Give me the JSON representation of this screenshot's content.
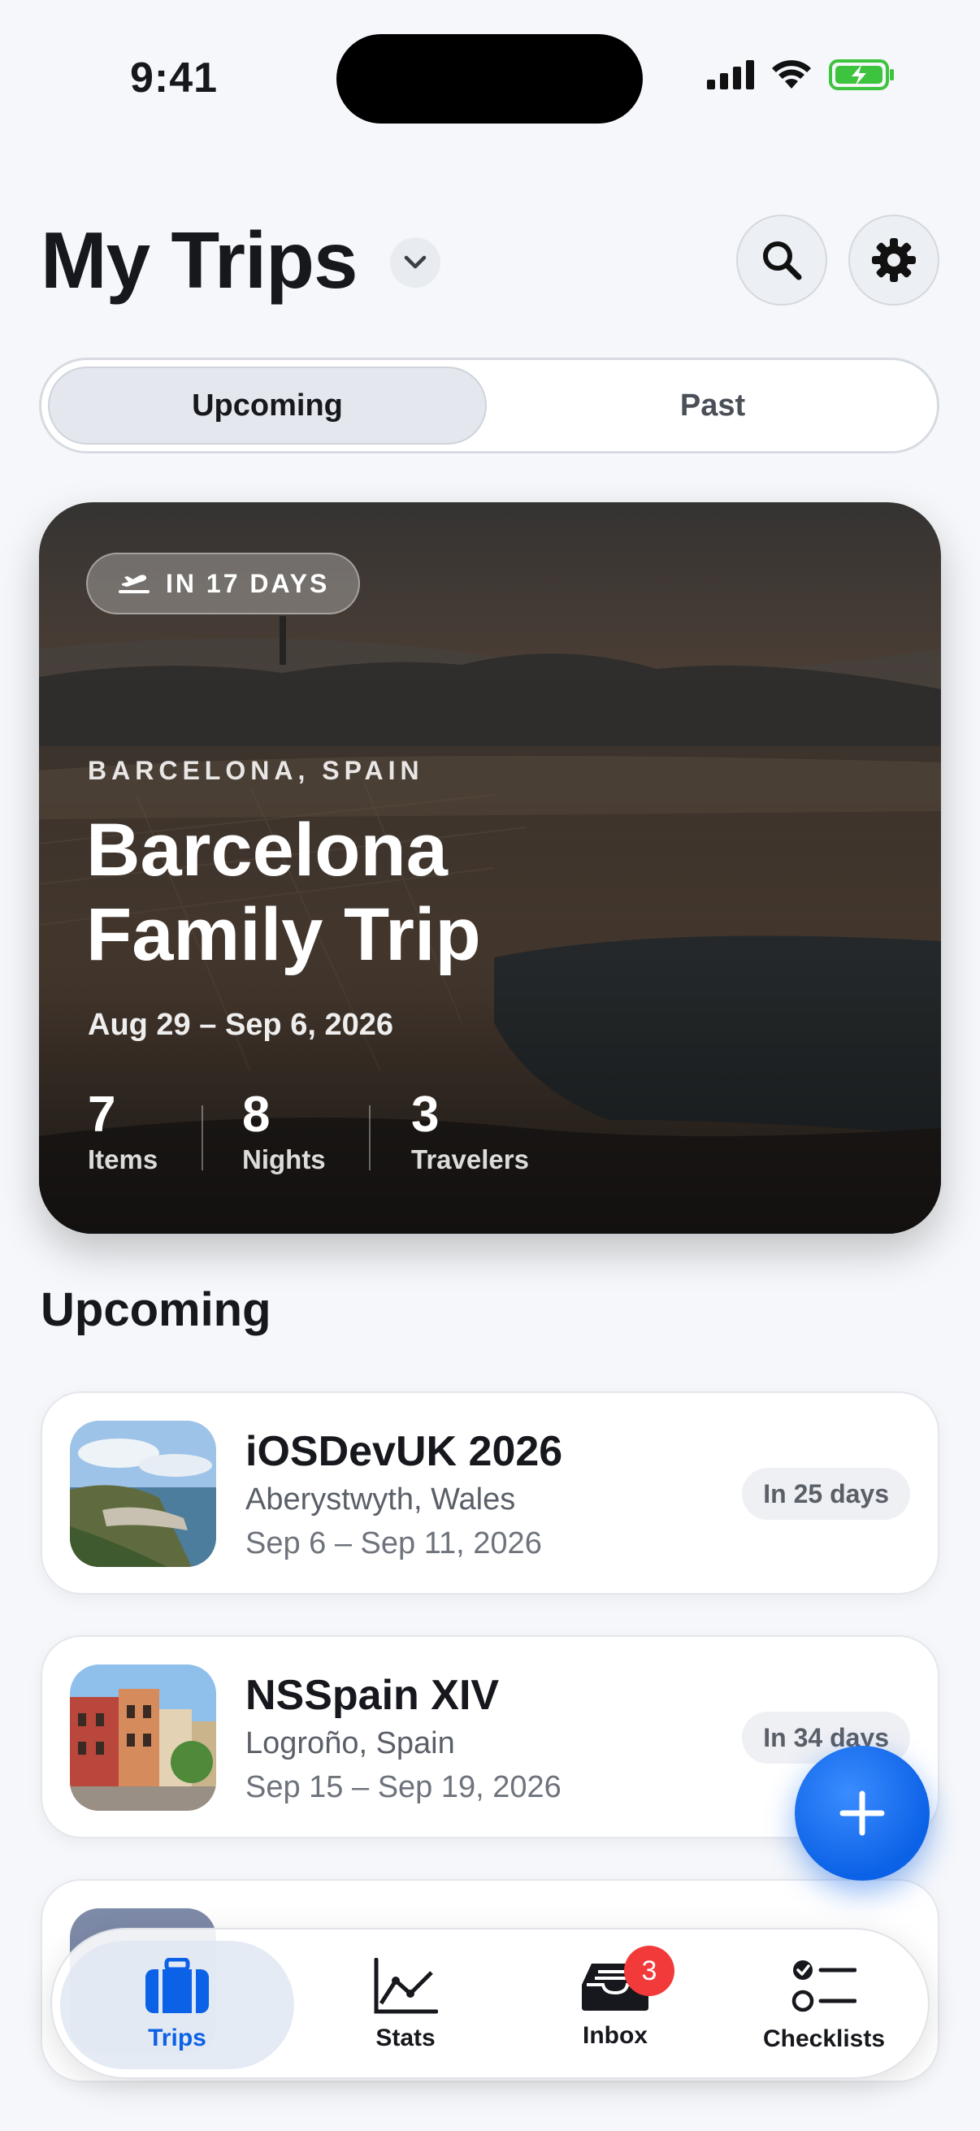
{
  "status_bar": {
    "time": "9:41"
  },
  "header": {
    "title": "My Trips",
    "icons": [
      "chevron-down-icon",
      "search-icon",
      "gear-icon"
    ]
  },
  "segmented": {
    "options": [
      "Upcoming",
      "Past"
    ],
    "selected": "Upcoming"
  },
  "featured": {
    "badge": "IN 17 DAYS",
    "location": "BARCELONA, SPAIN",
    "title": "Barcelona Family Trip",
    "dates": "Aug 29 – Sep 6, 2026",
    "stats": [
      {
        "value": "7",
        "label": "Items"
      },
      {
        "value": "8",
        "label": "Nights"
      },
      {
        "value": "3",
        "label": "Travelers"
      }
    ]
  },
  "upcoming": {
    "heading": "Upcoming",
    "trips": [
      {
        "name": "iOSDevUK 2026",
        "place": "Aberystwyth, Wales",
        "dates": "Sep 6 – Sep 11, 2026",
        "countdown": "In 25 days"
      },
      {
        "name": "NSSpain XIV",
        "place": "Logroño, Spain",
        "dates": "Sep 15 – Sep 19, 2026",
        "countdown": "In 34 days"
      }
    ]
  },
  "tab_bar": {
    "tabs": [
      {
        "label": "Trips",
        "icon": "suitcase-icon",
        "active": true
      },
      {
        "label": "Stats",
        "icon": "chart-icon"
      },
      {
        "label": "Inbox",
        "icon": "inbox-icon",
        "badge": "3"
      },
      {
        "label": "Checklists",
        "icon": "checklist-icon"
      }
    ]
  },
  "colors": {
    "accent": "#0c62e6",
    "badge_red": "#f23a3a",
    "background": "#f5f7fa"
  }
}
